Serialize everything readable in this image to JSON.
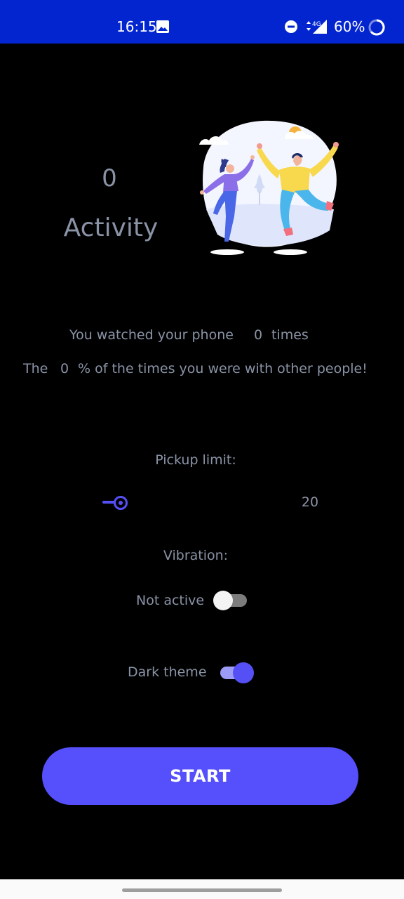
{
  "status_bar": {
    "time": "16:15",
    "network": "4G",
    "battery": "60%",
    "icons": [
      "gallery-icon",
      "do-not-disturb-icon",
      "signal-icon",
      "battery-icon"
    ]
  },
  "activity": {
    "count": "0",
    "label": "Activity"
  },
  "stats": {
    "line1_prefix": "You watched your phone",
    "line1_value": "0",
    "line1_suffix": "times",
    "line2_prefix": "The",
    "line2_value": "0",
    "line2_suffix": "% of the times you were with other people!"
  },
  "pickup": {
    "label": "Pickup limit:",
    "value": "20",
    "slider_fraction": 0.0
  },
  "vibration": {
    "label": "Vibration:",
    "state": "Not active",
    "enabled": false
  },
  "theme": {
    "label": "Dark theme",
    "enabled": true
  },
  "start_button": {
    "label": "START"
  },
  "colors": {
    "status_bar": "#0325d0",
    "accent": "#5550fb",
    "background": "#000000",
    "text": "#8a93a6"
  }
}
